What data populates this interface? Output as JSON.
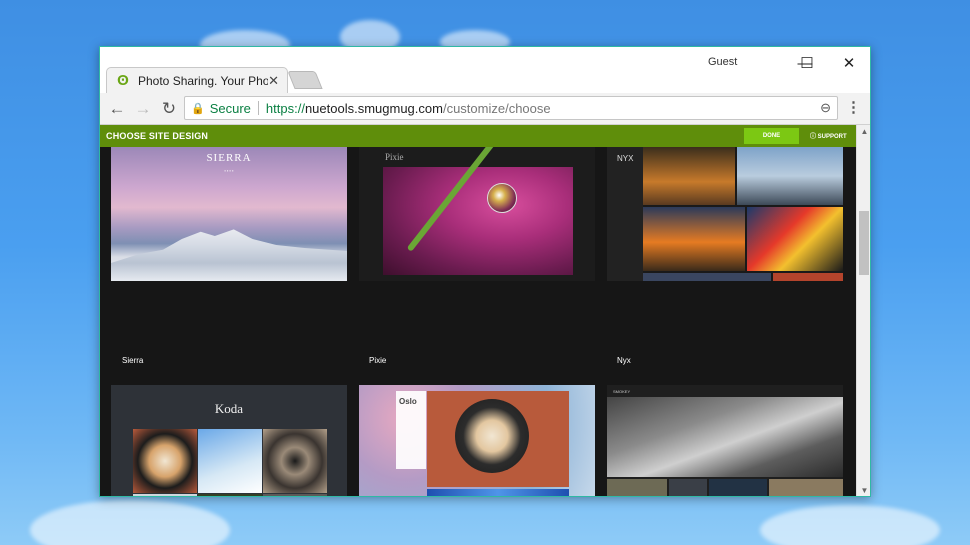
{
  "browser": {
    "tab_title": "Photo Sharing. Your Phot",
    "tab_close": "✕",
    "profile": "Guest",
    "window_controls": {
      "minimize": "—",
      "maximize": "☐",
      "close": "✕"
    },
    "nav": {
      "back": "←",
      "forward": "→",
      "reload": "↻"
    },
    "security_label": "Secure",
    "url_scheme": "https://",
    "url_host": "nuetools.smugmug.com",
    "url_path": "/customize/choose",
    "menu": "⋮",
    "zoom_icon": "⊖"
  },
  "page": {
    "header_title": "CHOOSE SITE DESIGN",
    "done_label": "DONE",
    "support_label": "SUPPORT"
  },
  "themes": [
    {
      "label": "Sierra",
      "preview_title": "SIERRA"
    },
    {
      "label": "Pixie",
      "preview_title": "Pixie"
    },
    {
      "label": "Nyx",
      "preview_title": "NYX"
    },
    {
      "preview_title": "Koda"
    },
    {
      "preview_title": "Oslo"
    },
    {
      "preview_title": "SMOKEY"
    }
  ],
  "colors": {
    "green_bar": "#5f8e0b",
    "done_button": "#7cc813",
    "secure_green": "#0b8043",
    "window_border": "#2fb9a4"
  }
}
